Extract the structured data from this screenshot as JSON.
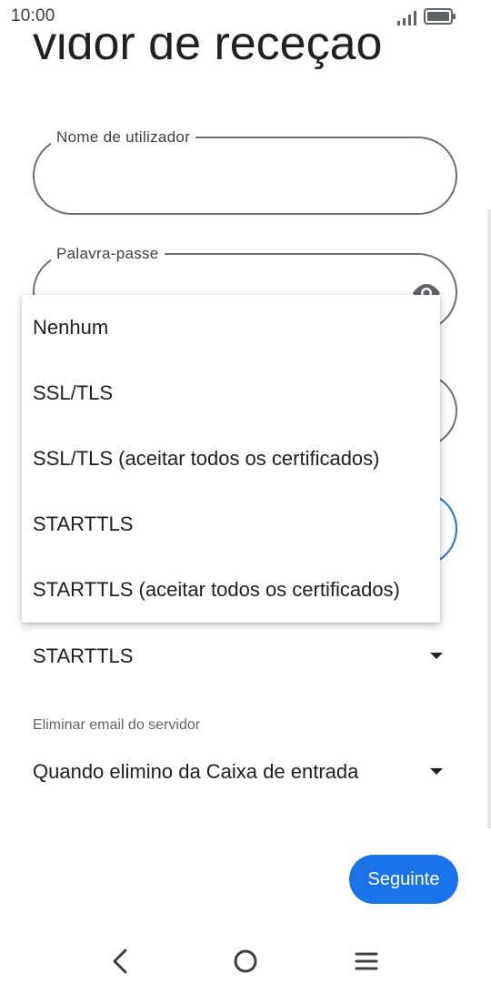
{
  "status_bar": {
    "time": "10:00",
    "icons": [
      "signal-icon",
      "battery-icon"
    ]
  },
  "page": {
    "title": "vidor de receção"
  },
  "fields": {
    "username": {
      "label": "Nome de utilizador",
      "value": ""
    },
    "password": {
      "label": "Palavra-passe",
      "value": "",
      "icon": "visibility-icon"
    }
  },
  "security_select": {
    "selected": "STARTTLS"
  },
  "delete_select": {
    "caption": "Eliminar email do servidor",
    "selected": "Quando elimino da Caixa de entrada"
  },
  "dropdown": {
    "options": [
      "Nenhum",
      "SSL/TLS",
      "SSL/TLS (aceitar todos os certificados)",
      "STARTTLS",
      "STARTTLS (aceitar todos os certificados)"
    ]
  },
  "actions": {
    "next_label": "Seguinte"
  },
  "nav": {
    "icons": [
      "back-icon",
      "home-icon",
      "menu-icon"
    ]
  },
  "colors": {
    "accent": "#1a73e8",
    "outline": "#6f6f6f",
    "text": "#202124"
  }
}
